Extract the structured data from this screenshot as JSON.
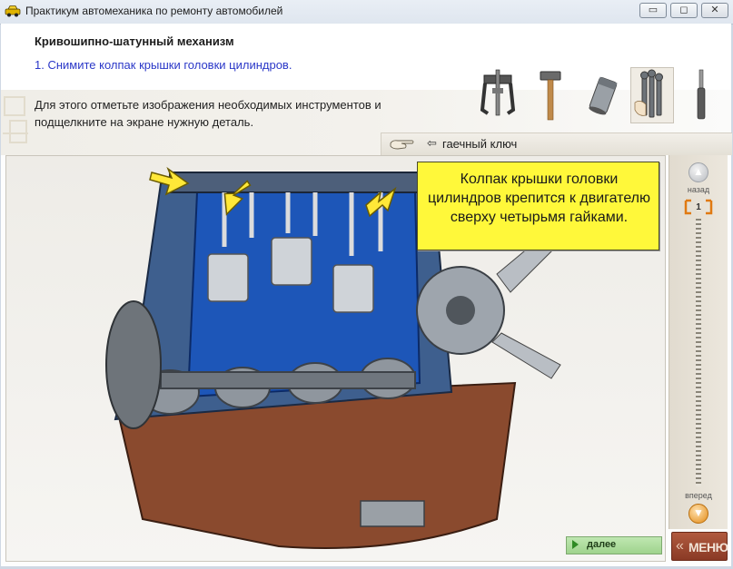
{
  "window": {
    "title": "Практикум автомеханика по ремонту автомобилей",
    "minimize_label": "▭",
    "maximize_label": "◻",
    "close_label": "✕"
  },
  "header": {
    "section_title": "Кривошипно-шатунный механизм",
    "step_text": "1. Снимите колпак крышки головки цилиндров."
  },
  "instruction": {
    "text": "Для этого отметьте изображения необходимых инструментов и подщелкните на экране нужную деталь."
  },
  "tools": [
    {
      "icon": "puller-icon",
      "selected": false
    },
    {
      "icon": "hammer-icon",
      "selected": false
    },
    {
      "icon": "socket-icon",
      "selected": false
    },
    {
      "icon": "wrench-set-icon",
      "selected": true
    },
    {
      "icon": "screwdriver-icon",
      "selected": false
    }
  ],
  "hint": {
    "arrow": "⇦",
    "selected_tool_text": "гаечный ключ"
  },
  "callout": {
    "text": "Колпак крышки головки цилиндров крепится к двигателю сверху четырьмя гайками."
  },
  "navigation": {
    "back_label": "назад",
    "counter": "1",
    "forward_label": "вперед",
    "up_glyph": "▲",
    "down_glyph": "▼"
  },
  "footer": {
    "next_label": "далее",
    "menu_label": "МЕНЮ",
    "menu_chevron": "«"
  },
  "colors": {
    "callout_bg": "#fff83a",
    "step_text": "#2b38c8",
    "engine_cutaway_blue": "#1d56b8",
    "next_button": "#a9da98",
    "menu_button": "#9a4630"
  }
}
